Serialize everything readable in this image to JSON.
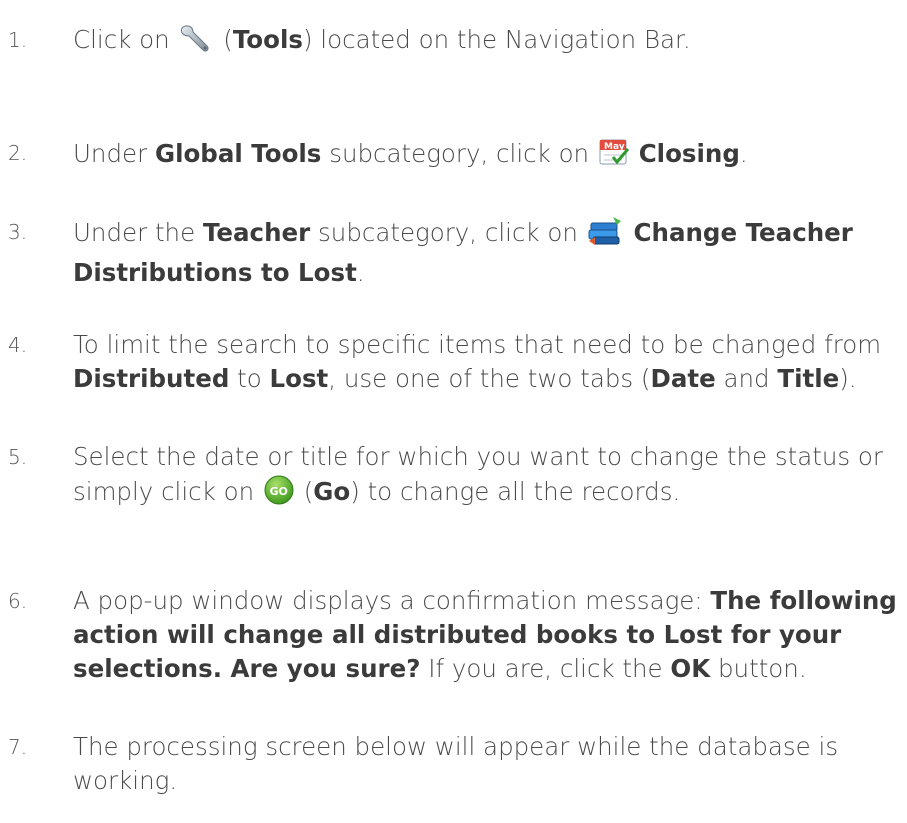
{
  "steps": [
    {
      "num": "1.",
      "pre": "Click on ",
      "icon": "wrench-icon",
      "mid1": " (",
      "bold1": "Tools",
      "post1": ") located on the Navigation Bar."
    },
    {
      "num": "2.",
      "pre": "Under ",
      "bold1": "Global Tools",
      "mid1": " subcategory, click on ",
      "icon": "may-calendar-icon",
      "icon_text": "May",
      "bold2": "Closing",
      "post": "."
    },
    {
      "num": "3.",
      "pre": "Under the ",
      "bold1": "Teacher",
      "mid1": " subcategory, click on ",
      "icon": "books-exchange-icon",
      "bold2": "Change Teacher",
      "bold3": "Distributions to Lost",
      "post": "."
    },
    {
      "num": "4.",
      "line1": "To limit the search to specific items that need to be changed from",
      "bold1": "Distributed",
      "mid1": " to ",
      "bold2": "Lost",
      "mid2": ", use one of the two tabs (",
      "bold3": "Date",
      "mid3": " and ",
      "bold4": "Title",
      "post": ")."
    },
    {
      "num": "5.",
      "line1": "Select the date or title for which you want to change the status or",
      "pre2": "simply click on ",
      "icon": "go-icon",
      "icon_text": "GO",
      "mid1": " (",
      "bold1": "Go",
      "post": ") to change all the records."
    },
    {
      "num": "6.",
      "pre": "A pop-up window displays a confirmation message: ",
      "bold1a": "The following",
      "bold1b": "action will change all distributed books to Lost for your",
      "bold1c": "selections.  Are you sure?",
      "mid1": "  If you are, click the ",
      "bold2": "OK",
      "post": " button."
    },
    {
      "num": "7.",
      "line1": "The processing screen below will appear while the database is",
      "line2": "working."
    }
  ],
  "colors": {
    "text": "#4a4a4a",
    "bold": "#3b3b3b",
    "go_green": "#5cb82e"
  }
}
